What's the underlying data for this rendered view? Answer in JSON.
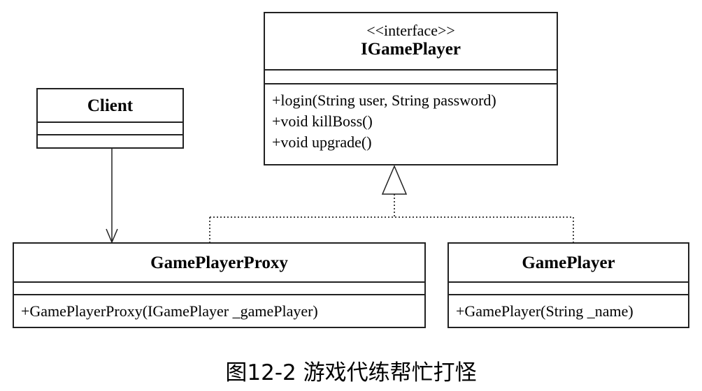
{
  "classes": {
    "igameplayer": {
      "stereotype": "<<interface>>",
      "name": "IGamePlayer",
      "operations": [
        "+login(String user, String password)",
        "+void killBoss()",
        "+void upgrade()"
      ]
    },
    "client": {
      "name": "Client"
    },
    "proxy": {
      "name": "GamePlayerProxy",
      "operations": [
        "+GamePlayerProxy(IGamePlayer _gamePlayer)"
      ]
    },
    "gameplayer": {
      "name": "GamePlayer",
      "operations": [
        "+GamePlayer(String _name)"
      ]
    }
  },
  "relations": [
    {
      "type": "dependency",
      "from": "Client",
      "to": "GamePlayerProxy"
    },
    {
      "type": "realization",
      "from": "GamePlayerProxy",
      "to": "IGamePlayer"
    },
    {
      "type": "realization",
      "from": "GamePlayer",
      "to": "IGamePlayer"
    }
  ],
  "caption": "图12-2 游戏代练帮忙打怪"
}
